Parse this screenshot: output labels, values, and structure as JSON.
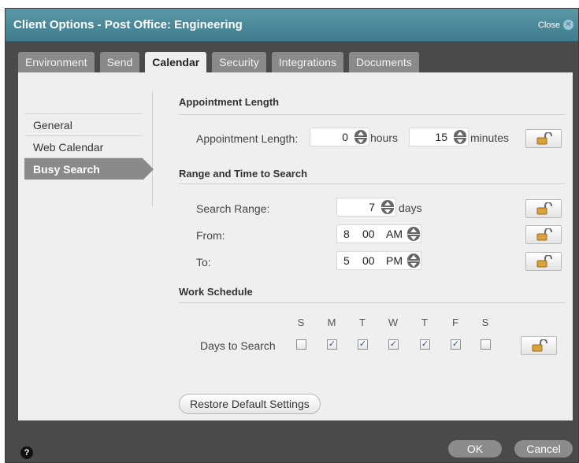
{
  "dialog": {
    "title": "Client Options - Post Office: Engineering",
    "close_label": "Close",
    "close_glyph": "✕"
  },
  "tabs": [
    {
      "label": "Environment"
    },
    {
      "label": "Send"
    },
    {
      "label": "Calendar",
      "active": true
    },
    {
      "label": "Security"
    },
    {
      "label": "Integrations"
    },
    {
      "label": "Documents"
    }
  ],
  "sidebar": {
    "items": [
      {
        "label": "General"
      },
      {
        "label": "Web Calendar"
      },
      {
        "label": "Busy Search",
        "active": true
      }
    ]
  },
  "appointment": {
    "section_title": "Appointment Length",
    "label": "Appointment Length:",
    "hours_value": "0",
    "hours_unit": "hours",
    "minutes_value": "15",
    "minutes_unit": "minutes"
  },
  "range": {
    "section_title": "Range and Time to Search",
    "search_range_label": "Search Range:",
    "search_range_value": "7",
    "search_range_unit": "days",
    "from_label": "From:",
    "from_hour": "8",
    "from_minute": "00",
    "from_ampm": "AM",
    "to_label": "To:",
    "to_hour": "5",
    "to_minute": "00",
    "to_ampm": "PM"
  },
  "schedule": {
    "section_title": "Work Schedule",
    "days_label": "Days to Search",
    "days": [
      {
        "letter": "S",
        "checked": false
      },
      {
        "letter": "M",
        "checked": true
      },
      {
        "letter": "T",
        "checked": true
      },
      {
        "letter": "W",
        "checked": true
      },
      {
        "letter": "T",
        "checked": true
      },
      {
        "letter": "F",
        "checked": true
      },
      {
        "letter": "S",
        "checked": false
      }
    ],
    "check_glyph": "✓"
  },
  "restore_label": "Restore Default Settings",
  "footer": {
    "help_glyph": "?",
    "ok_label": "OK",
    "cancel_label": "Cancel"
  },
  "icons": {
    "lock": "lock-icon",
    "spinner": "spinner-icon"
  },
  "colors": {
    "titlebar": "#4a8a9b",
    "tab_inactive": "#8a8a8a",
    "panel": "#efefef",
    "lock_gold": "#d9a23a"
  }
}
